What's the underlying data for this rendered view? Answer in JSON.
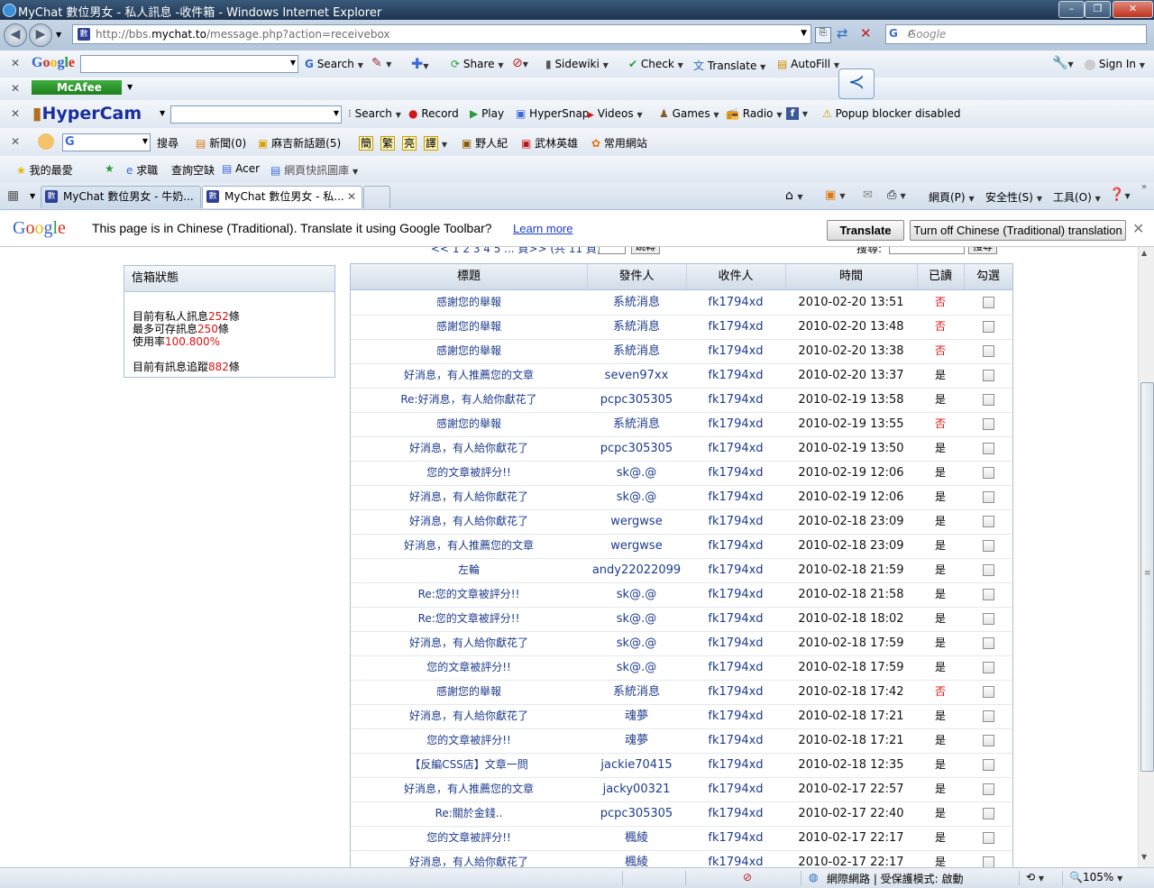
{
  "window": {
    "title": "MyChat 數位男女 - 私人訊息 -收件箱 - Windows Internet Explorer"
  },
  "address": {
    "url_prefix": "http://bbs.",
    "url_domain": "mychat.to",
    "url_path": "/message.php?action=receivebox",
    "search_placeholder": "Google"
  },
  "google_toolbar": {
    "logo": "Google",
    "search": "Search",
    "share": "Share",
    "sidewiki": "Sidewiki",
    "check": "Check",
    "translate": "Translate",
    "autofill": "AutoFill",
    "sign_in": "Sign In"
  },
  "mcafee_toolbar": {
    "label": "McAfee"
  },
  "hypercam_toolbar": {
    "logo": "HyperCam",
    "search": "Search",
    "record": "Record",
    "play": "Play",
    "hypersnap": "HyperSnap",
    "videos": "Videos",
    "games": "Games",
    "radio": "Radio",
    "popup": "Popup blocker disabled"
  },
  "cn_toolbar": {
    "search": "搜尋",
    "news": "新聞(0)",
    "topics": "麻吉新話題(5)",
    "simp": "簡",
    "trad": "繁",
    "mars": "亮",
    "trans": "譯",
    "site1": "野人紀",
    "site2": "武林英雄",
    "site3": "常用網站"
  },
  "favorites_bar": {
    "favorites": "我的最愛",
    "item1": "求職",
    "item2": "查詢空缺",
    "item3": "Acer",
    "item4": "網頁快訊圖庫"
  },
  "tabs": [
    {
      "label": "MyChat 數位男女 - 牛奶..."
    },
    {
      "label": "MyChat 數位男女 - 私..."
    }
  ],
  "command_bar": {
    "page": "網頁(P)",
    "safety": "安全性(S)",
    "tools": "工具(O)"
  },
  "translate_bar": {
    "message": "This page is in Chinese (Traditional).  Translate it using Google Toolbar?",
    "learn_more": "Learn more",
    "translate_btn": "Translate",
    "turn_off_btn": "Turn off Chinese (Traditional) translation"
  },
  "pager": {
    "text": "<< 1 2 3 4 5 ... 頁>> (共 11 頁)",
    "go": "跳轉",
    "search_label": "搜尋:",
    "search_btn": "搜尋"
  },
  "mailbox": {
    "title": "信箱狀態",
    "line1_pre": "目前有私人訊息",
    "line1_num": "252",
    "line1_post": "條",
    "line2_pre": "最多可存訊息",
    "line2_num": "250",
    "line2_post": "條",
    "line3_pre": "使用率",
    "line3_num": "100.800%",
    "line4_pre": "目前有訊息追蹤",
    "line4_num": "882",
    "line4_post": "條"
  },
  "table": {
    "headers": {
      "subject": "標題",
      "from": "發件人",
      "to": "收件人",
      "time": "時間",
      "read": "已讀",
      "select": "勾選"
    },
    "rows": [
      {
        "subject": "感謝您的舉報",
        "from": "系統消息",
        "to": "fk1794xd",
        "time": "2010-02-20 13:51",
        "read": "否"
      },
      {
        "subject": "感謝您的舉報",
        "from": "系統消息",
        "to": "fk1794xd",
        "time": "2010-02-20 13:48",
        "read": "否"
      },
      {
        "subject": "感謝您的舉報",
        "from": "系統消息",
        "to": "fk1794xd",
        "time": "2010-02-20 13:38",
        "read": "否"
      },
      {
        "subject": "好消息，有人推薦您的文章",
        "from": "seven97xx",
        "to": "fk1794xd",
        "time": "2010-02-20 13:37",
        "read": "是"
      },
      {
        "subject": "Re:好消息，有人給你獻花了",
        "from": "pcpc305305",
        "to": "fk1794xd",
        "time": "2010-02-19 13:58",
        "read": "是"
      },
      {
        "subject": "感謝您的舉報",
        "from": "系統消息",
        "to": "fk1794xd",
        "time": "2010-02-19 13:55",
        "read": "否"
      },
      {
        "subject": "好消息，有人給你獻花了",
        "from": "pcpc305305",
        "to": "fk1794xd",
        "time": "2010-02-19 13:50",
        "read": "是"
      },
      {
        "subject": "您的文章被評分!!",
        "from": "sk@.@",
        "to": "fk1794xd",
        "time": "2010-02-19 12:06",
        "read": "是"
      },
      {
        "subject": "好消息，有人給你獻花了",
        "from": "sk@.@",
        "to": "fk1794xd",
        "time": "2010-02-19 12:06",
        "read": "是"
      },
      {
        "subject": "好消息，有人給你獻花了",
        "from": "wergwse",
        "to": "fk1794xd",
        "time": "2010-02-18 23:09",
        "read": "是"
      },
      {
        "subject": "好消息，有人推薦您的文章",
        "from": "wergwse",
        "to": "fk1794xd",
        "time": "2010-02-18 23:09",
        "read": "是"
      },
      {
        "subject": "左輪",
        "from": "andy22022099",
        "to": "fk1794xd",
        "time": "2010-02-18 21:59",
        "read": "是"
      },
      {
        "subject": "Re:您的文章被評分!!",
        "from": "sk@.@",
        "to": "fk1794xd",
        "time": "2010-02-18 21:58",
        "read": "是"
      },
      {
        "subject": "Re:您的文章被評分!!",
        "from": "sk@.@",
        "to": "fk1794xd",
        "time": "2010-02-18 18:02",
        "read": "是"
      },
      {
        "subject": "好消息，有人給你獻花了",
        "from": "sk@.@",
        "to": "fk1794xd",
        "time": "2010-02-18 17:59",
        "read": "是"
      },
      {
        "subject": "您的文章被評分!!",
        "from": "sk@.@",
        "to": "fk1794xd",
        "time": "2010-02-18 17:59",
        "read": "是"
      },
      {
        "subject": "感謝您的舉報",
        "from": "系統消息",
        "to": "fk1794xd",
        "time": "2010-02-18 17:42",
        "read": "否"
      },
      {
        "subject": "好消息，有人給你獻花了",
        "from": "魂夢",
        "to": "fk1794xd",
        "time": "2010-02-18 17:21",
        "read": "是"
      },
      {
        "subject": "您的文章被評分!!",
        "from": "魂夢",
        "to": "fk1794xd",
        "time": "2010-02-18 17:21",
        "read": "是"
      },
      {
        "subject": "【反編CSS店】文章一問",
        "from": "jackie70415",
        "to": "fk1794xd",
        "time": "2010-02-18 12:35",
        "read": "是"
      },
      {
        "subject": "好消息，有人推薦您的文章",
        "from": "jacky00321",
        "to": "fk1794xd",
        "time": "2010-02-17 22:57",
        "read": "是"
      },
      {
        "subject": "Re:關於金錢..",
        "from": "pcpc305305",
        "to": "fk1794xd",
        "time": "2010-02-17 22:40",
        "read": "是"
      },
      {
        "subject": "您的文章被評分!!",
        "from": "楓綾",
        "to": "fk1794xd",
        "time": "2010-02-17 22:17",
        "read": "是"
      },
      {
        "subject": "好消息，有人給你獻花了",
        "from": "楓綾",
        "to": "fk1794xd",
        "time": "2010-02-17 22:17",
        "read": "是"
      }
    ]
  },
  "status_bar": {
    "zone": "網際網路 | 受保護模式: 啟動",
    "zoom": "105%"
  },
  "colors": {
    "unread": "#e01010",
    "link": "#1e3c8c"
  }
}
